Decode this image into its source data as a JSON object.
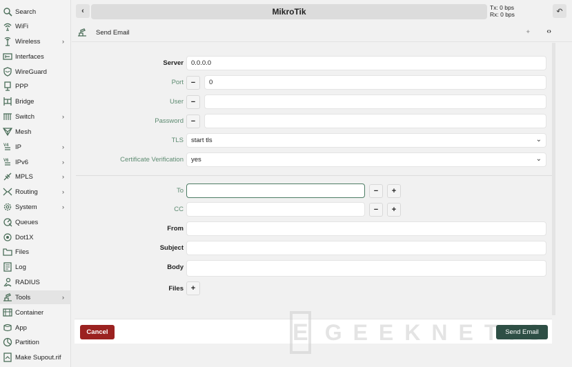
{
  "sidebar": {
    "items": [
      {
        "label": "Search",
        "icon": "search-icon",
        "chevron": false
      },
      {
        "label": "WiFi",
        "icon": "wifi-icon",
        "chevron": false
      },
      {
        "label": "Wireless",
        "icon": "antenna-icon",
        "chevron": true
      },
      {
        "label": "Interfaces",
        "icon": "interfaces-icon",
        "chevron": false
      },
      {
        "label": "WireGuard",
        "icon": "shield-icon",
        "chevron": false
      },
      {
        "label": "PPP",
        "icon": "ppp-icon",
        "chevron": false
      },
      {
        "label": "Bridge",
        "icon": "bridge-icon",
        "chevron": false
      },
      {
        "label": "Switch",
        "icon": "switch-icon",
        "chevron": true
      },
      {
        "label": "Mesh",
        "icon": "mesh-icon",
        "chevron": false
      },
      {
        "label": "IP",
        "icon": "ip-icon",
        "chevron": true
      },
      {
        "label": "IPv6",
        "icon": "ipv6-icon",
        "chevron": true
      },
      {
        "label": "MPLS",
        "icon": "mpls-icon",
        "chevron": true
      },
      {
        "label": "Routing",
        "icon": "routing-icon",
        "chevron": true
      },
      {
        "label": "System",
        "icon": "gear-icon",
        "chevron": true
      },
      {
        "label": "Queues",
        "icon": "queues-icon",
        "chevron": false
      },
      {
        "label": "Dot1X",
        "icon": "dot1x-icon",
        "chevron": false
      },
      {
        "label": "Files",
        "icon": "folder-icon",
        "chevron": false
      },
      {
        "label": "Log",
        "icon": "log-icon",
        "chevron": false
      },
      {
        "label": "RADIUS",
        "icon": "radius-icon",
        "chevron": false
      },
      {
        "label": "Tools",
        "icon": "tools-icon",
        "chevron": true,
        "active": true
      },
      {
        "label": "Container",
        "icon": "container-icon",
        "chevron": false
      },
      {
        "label": "App",
        "icon": "app-icon",
        "chevron": false
      },
      {
        "label": "Partition",
        "icon": "partition-icon",
        "chevron": false
      },
      {
        "label": "Make Supout.rif",
        "icon": "supout-icon",
        "chevron": false
      }
    ]
  },
  "topbar": {
    "back_label": "‹",
    "title": "MikroTik",
    "tx": "Tx: 0 bps",
    "rx": "Rx: 0 bps",
    "undo_label": "↶"
  },
  "subheader": {
    "title": "Send Email",
    "pin_label": "✦",
    "code_label": "‹›"
  },
  "form": {
    "server": {
      "label": "Server",
      "value": "0.0.0.0"
    },
    "port": {
      "label": "Port",
      "value": "0"
    },
    "user": {
      "label": "User",
      "value": ""
    },
    "password": {
      "label": "Password",
      "value": ""
    },
    "tls": {
      "label": "TLS",
      "value": "start tls"
    },
    "cert": {
      "label": "Certificate Verification",
      "value": "yes"
    },
    "to": {
      "label": "To",
      "value": ""
    },
    "cc": {
      "label": "CC",
      "value": ""
    },
    "from": {
      "label": "From",
      "value": ""
    },
    "subject": {
      "label": "Subject",
      "value": ""
    },
    "body": {
      "label": "Body",
      "value": ""
    },
    "files": {
      "label": "Files"
    }
  },
  "controls": {
    "minus": "−",
    "plus": "+",
    "chevron": "⌄"
  },
  "footer": {
    "cancel_label": "Cancel",
    "send_label": "Send Email",
    "watermark": "GEEKNETIC",
    "watermark_logo": "E"
  },
  "colors": {
    "accent": "#2e4f45",
    "cancel": "#9b2220",
    "label_muted": "#5c8a70"
  }
}
